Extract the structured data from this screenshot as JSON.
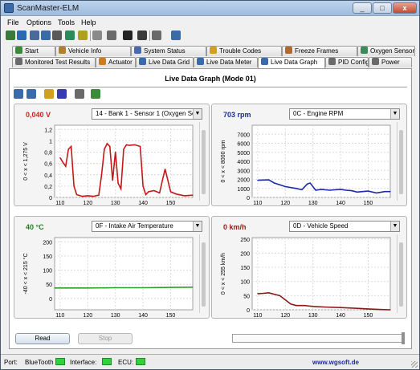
{
  "window": {
    "title": "ScanMaster-ELM"
  },
  "menu": [
    "File",
    "Options",
    "Tools",
    "Help"
  ],
  "toolbar_icons": [
    "connect-icon",
    "globe-icon",
    "monitor-icon",
    "grid-icon",
    "chip-icon",
    "trash-icon",
    "graph-icon",
    "clipboard-icon",
    "terminal-icon",
    "display-icon",
    "gauge-icon",
    "info-icon",
    "help-book-icon"
  ],
  "tabs_row1": [
    {
      "label": "Start",
      "icon": "start-icon",
      "color": "#3a8a3a"
    },
    {
      "label": "Vehicle Info",
      "icon": "wrench-icon",
      "color": "#b08030"
    },
    {
      "label": "System Status",
      "icon": "status-icon",
      "color": "#4a6ab0"
    },
    {
      "label": "Trouble Codes",
      "icon": "warning-icon",
      "color": "#d0a020"
    },
    {
      "label": "Freeze Frames",
      "icon": "freeze-icon",
      "color": "#b06a30"
    },
    {
      "label": "Oxygen Sensors",
      "icon": "oxygen-icon",
      "color": "#3a8a5a"
    }
  ],
  "tabs_row2": [
    {
      "label": "Monitored Test Results",
      "icon": "test-icon",
      "color": "#6a6a6a"
    },
    {
      "label": "Actuator",
      "icon": "actuator-icon",
      "color": "#d07a20"
    },
    {
      "label": "Live Data Grid",
      "icon": "grid-icon",
      "color": "#3a6aa8"
    },
    {
      "label": "Live Data Meter",
      "icon": "meter-icon",
      "color": "#3a6aa8"
    },
    {
      "label": "Live Data Graph",
      "icon": "graph-icon",
      "color": "#3a6aa8"
    },
    {
      "label": "PID Config",
      "icon": "config-icon",
      "color": "#6a6a6a"
    },
    {
      "label": "Power",
      "icon": "power-icon",
      "color": "#6a6a6a"
    }
  ],
  "panel": {
    "heading": "Live Data Graph (Mode 01)"
  },
  "graphs": [
    {
      "value": "0,040 V",
      "value_color": "#d02020",
      "selector": "14 - Bank 1 - Sensor 1 (Oxygen Senso",
      "y_axis_label": "0 < x < 1,275 V",
      "line_color": "#c41818",
      "chart_data": {
        "type": "line",
        "x": [
          110,
          111,
          112,
          113,
          114,
          115,
          116,
          118,
          120,
          122,
          124,
          125,
          126,
          127,
          128,
          129,
          130,
          131,
          132,
          133,
          134,
          135,
          137,
          139,
          140,
          141,
          142,
          144,
          146,
          147,
          148,
          150,
          152,
          155,
          158
        ],
        "y": [
          0.7,
          0.62,
          0.55,
          0.85,
          0.9,
          0.2,
          0.05,
          0.02,
          0.03,
          0.02,
          0.04,
          0.4,
          0.85,
          0.95,
          0.9,
          0.3,
          0.8,
          0.25,
          0.15,
          0.85,
          0.93,
          0.92,
          0.93,
          0.9,
          0.2,
          0.05,
          0.1,
          0.12,
          0.08,
          0.3,
          0.5,
          0.1,
          0.06,
          0.03,
          0.04
        ],
        "x_ticks": [
          "110",
          "120",
          "130",
          "140",
          "150"
        ],
        "y_ticks": [
          "0",
          "0,2",
          "0,4",
          "0,6",
          "0,8",
          "1",
          "1,2"
        ],
        "xlim": [
          108,
          158
        ],
        "ylim": [
          0,
          1.275
        ]
      }
    },
    {
      "value": "703 rpm",
      "value_color": "#1a2a9a",
      "selector": "0C - Engine RPM",
      "y_axis_label": "0 < x < 8000 rpm",
      "line_color": "#1a2aa8",
      "chart_data": {
        "type": "line",
        "x": [
          110,
          114,
          116,
          120,
          124,
          126,
          128,
          129,
          131,
          133,
          136,
          140,
          142,
          144,
          146,
          150,
          153,
          156,
          158
        ],
        "y": [
          1900,
          1950,
          1600,
          1200,
          1000,
          850,
          1500,
          1600,
          800,
          900,
          800,
          900,
          800,
          750,
          600,
          700,
          500,
          650,
          650
        ],
        "x_ticks": [
          "110",
          "120",
          "130",
          "140",
          "150"
        ],
        "y_ticks": [
          "0",
          "1000",
          "2000",
          "3000",
          "4000",
          "5000",
          "6000",
          "7000"
        ],
        "xlim": [
          108,
          158
        ],
        "ylim": [
          0,
          8000
        ]
      }
    },
    {
      "value": "40 °C",
      "value_color": "#2a7a2a",
      "selector": "0F - Intake Air Temperature",
      "y_axis_label": "-40 < x < 215 °C",
      "line_color": "#2aa02a",
      "chart_data": {
        "type": "line",
        "x": [
          108,
          120,
          130,
          140,
          150,
          158
        ],
        "y": [
          37,
          37,
          38,
          38,
          39,
          40
        ],
        "x_ticks": [
          "110",
          "120",
          "130",
          "140",
          "150"
        ],
        "y_ticks": [
          "0",
          "50",
          "100",
          "150",
          "200"
        ],
        "xlim": [
          108,
          158
        ],
        "ylim": [
          -40,
          215
        ]
      }
    },
    {
      "value": "0 km/h",
      "value_color": "#a01818",
      "selector": "0D - Vehicle Speed",
      "y_axis_label": "0 < x < 255 km/h",
      "line_color": "#8a1818",
      "chart_data": {
        "type": "line",
        "x": [
          110,
          112,
          114,
          116,
          118,
          120,
          122,
          124,
          127,
          130,
          134,
          140,
          146,
          150,
          154,
          158
        ],
        "y": [
          57,
          58,
          60,
          55,
          50,
          35,
          20,
          15,
          15,
          12,
          10,
          8,
          5,
          3,
          1,
          0
        ],
        "x_ticks": [
          "110",
          "120",
          "130",
          "140",
          "150"
        ],
        "y_ticks": [
          "0",
          "50",
          "100",
          "150",
          "200",
          "250"
        ],
        "xlim": [
          108,
          158
        ],
        "ylim": [
          0,
          255
        ]
      }
    }
  ],
  "buttons": {
    "read": "Read",
    "stop": "Stop"
  },
  "status": {
    "port_label": "Port:",
    "port_value": "BlueTooth",
    "interface_label": "Interface:",
    "ecu_label": "ECU:",
    "url": "www.wgsoft.de"
  }
}
